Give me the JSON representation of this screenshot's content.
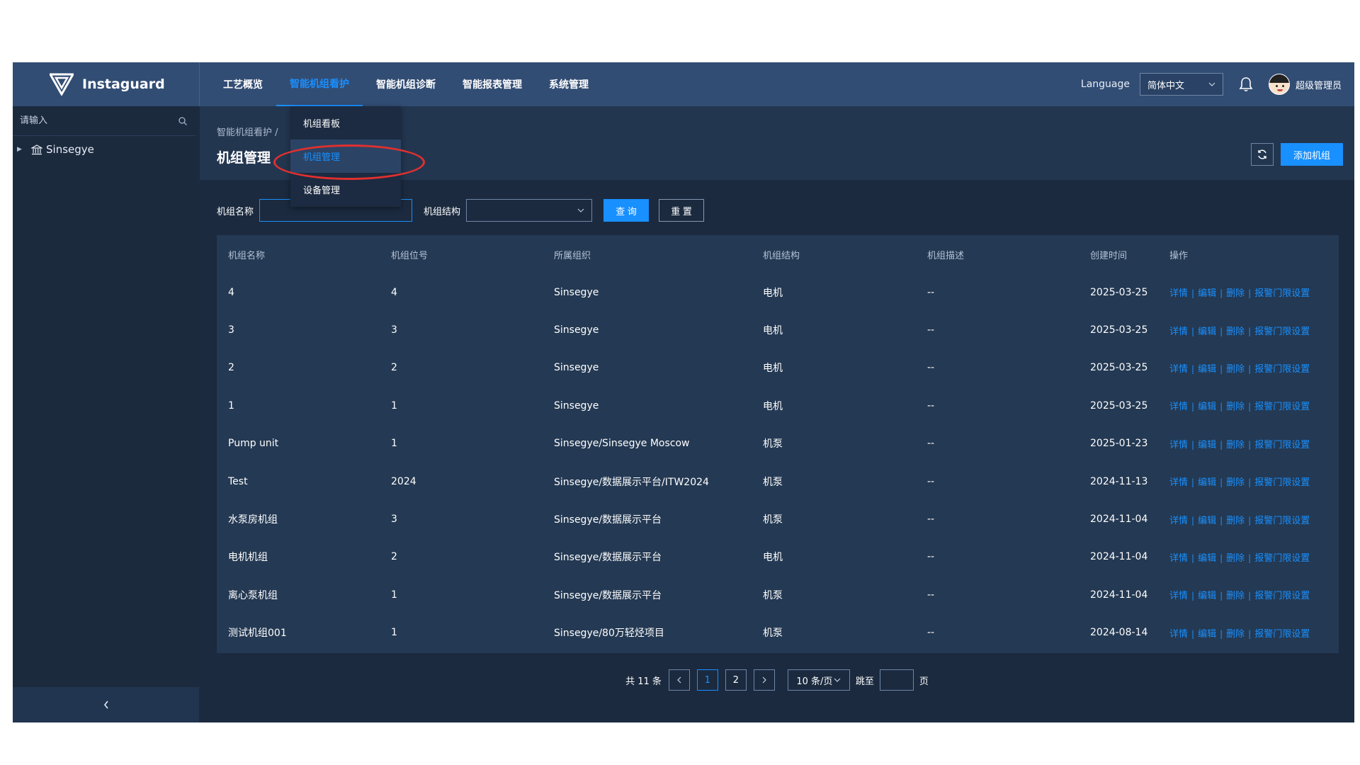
{
  "header": {
    "brand": "Instaguard",
    "nav": [
      {
        "label": "工艺概览",
        "active": false
      },
      {
        "label": "智能机组看护",
        "active": true
      },
      {
        "label": "智能机组诊断",
        "active": false
      },
      {
        "label": "智能报表管理",
        "active": false
      },
      {
        "label": "系统管理",
        "active": false
      }
    ],
    "language_label": "Language",
    "language_value": "简体中文",
    "user_name": "超级管理员"
  },
  "dropdown": {
    "items": [
      {
        "label": "机组看板",
        "selected": false
      },
      {
        "label": "机组管理",
        "selected": true
      },
      {
        "label": "设备管理",
        "selected": false
      }
    ]
  },
  "sidebar": {
    "search_placeholder": "请输入",
    "tree_root": "Sinsegye",
    "collapse_icon": "chevron-left-icon"
  },
  "page": {
    "breadcrumb": "智能机组看护 /",
    "title": "机组管理",
    "add_button": "添加机组"
  },
  "filter": {
    "name_label": "机组名称",
    "name_value": "",
    "structure_label": "机组结构",
    "structure_value": "",
    "query_button": "查 询",
    "reset_button": "重 置"
  },
  "table": {
    "columns": [
      "机组名称",
      "机组位号",
      "所属组织",
      "机组结构",
      "机组描述",
      "创建时间",
      "操作"
    ],
    "rows": [
      [
        "4",
        "4",
        "Sinsegye",
        "电机",
        "--",
        "2025-03-25"
      ],
      [
        "3",
        "3",
        "Sinsegye",
        "电机",
        "--",
        "2025-03-25"
      ],
      [
        "2",
        "2",
        "Sinsegye",
        "电机",
        "--",
        "2025-03-25"
      ],
      [
        "1",
        "1",
        "Sinsegye",
        "电机",
        "--",
        "2025-03-25"
      ],
      [
        "Pump unit",
        "1",
        "Sinsegye/Sinsegye Moscow",
        "机泵",
        "--",
        "2025-01-23"
      ],
      [
        "Test",
        "2024",
        "Sinsegye/数据展示平台/ITW2024",
        "机泵",
        "--",
        "2024-11-13"
      ],
      [
        "水泵房机组",
        "3",
        "Sinsegye/数据展示平台",
        "机泵",
        "--",
        "2024-11-04"
      ],
      [
        "电机机组",
        "2",
        "Sinsegye/数据展示平台",
        "电机",
        "--",
        "2024-11-04"
      ],
      [
        "离心泵机组",
        "1",
        "Sinsegye/数据展示平台",
        "机泵",
        "--",
        "2024-11-04"
      ],
      [
        "测试机组001",
        "1",
        "Sinsegye/80万轻烃项目",
        "机泵",
        "--",
        "2024-08-14"
      ]
    ],
    "actions": [
      "详情",
      "编辑",
      "删除",
      "报警门限设置"
    ]
  },
  "pagination": {
    "total_text": "共 11 条",
    "pages": [
      "1",
      "2"
    ],
    "current_page": "1",
    "page_size": "10 条/页",
    "jump_label": "跳至",
    "page_suffix": "页"
  },
  "colors": {
    "accent": "#1890ff",
    "header_bg": "#324d74",
    "body_bg": "#1b2a3f",
    "annotation": "#e0302e"
  }
}
